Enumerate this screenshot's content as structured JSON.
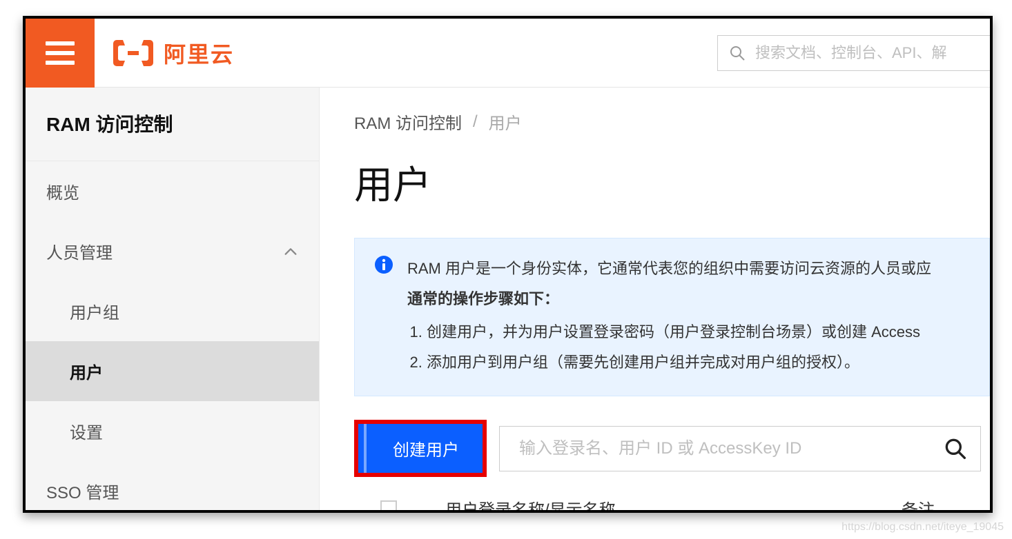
{
  "topbar": {
    "brand_text": "阿里云",
    "search_placeholder": "搜索文档、控制台、API、解"
  },
  "sidebar": {
    "title": "RAM 访问控制",
    "items": [
      {
        "label": "概览",
        "level": 0,
        "active": false,
        "expandable": false
      },
      {
        "label": "人员管理",
        "level": 0,
        "active": false,
        "expandable": true
      },
      {
        "label": "用户组",
        "level": 1,
        "active": false,
        "expandable": false
      },
      {
        "label": "用户",
        "level": 1,
        "active": true,
        "expandable": false
      },
      {
        "label": "设置",
        "level": 1,
        "active": false,
        "expandable": false
      },
      {
        "label": "SSO 管理",
        "level": 0,
        "active": false,
        "expandable": false
      }
    ]
  },
  "breadcrumb": {
    "root": "RAM 访问控制",
    "separator": "/",
    "current": "用户"
  },
  "page": {
    "title": "用户"
  },
  "info": {
    "description": "RAM 用户是一个身份实体，它通常代表您的组织中需要访问云资源的人员或应",
    "sub_heading": "通常的操作步骤如下：",
    "steps": [
      "创建用户，并为用户设置登录密码（用户登录控制台场景）或创建 Access",
      "添加用户到用户组（需要先创建用户组并完成对用户组的授权）。"
    ]
  },
  "actions": {
    "create_button": "创建用户",
    "user_search_placeholder": "输入登录名、用户 ID 或 AccessKey ID"
  },
  "table": {
    "col_name": "用户登录名称/显示名称",
    "col_remark": "备注"
  },
  "watermark": "https://blog.csdn.net/iteye_19045"
}
